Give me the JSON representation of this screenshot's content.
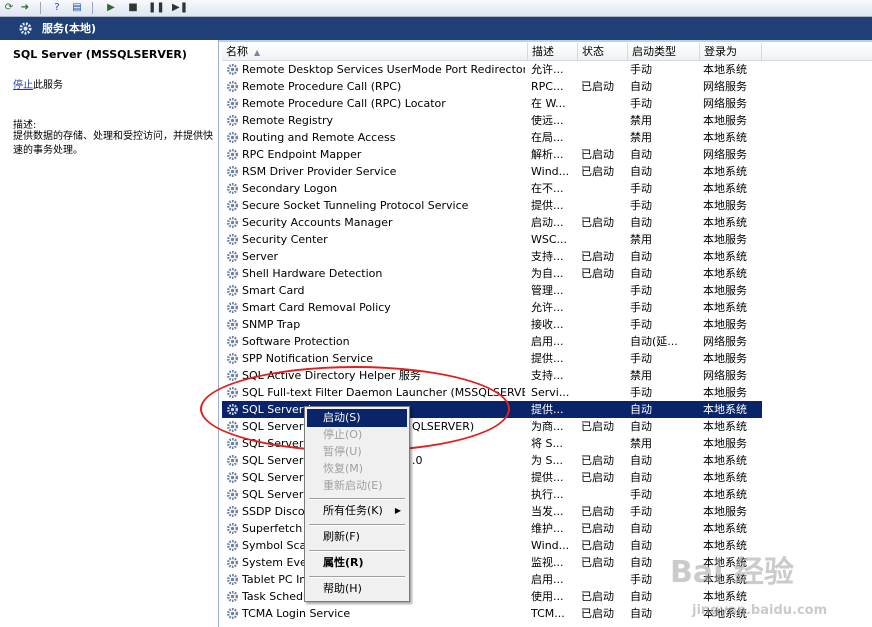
{
  "header": {
    "title": "服务(本地)"
  },
  "left_pane": {
    "service_title": "SQL Server (MSSQLSERVER)",
    "stop_link": "停止",
    "stop_suffix": "此服务",
    "desc_label": "描述:",
    "desc_text": "提供数据的存储、处理和受控访问，并提供快速的事务处理。"
  },
  "columns": [
    "名称",
    "描述",
    "状态",
    "启动类型",
    "登录为"
  ],
  "services": [
    {
      "name": "Remote Desktop Services UserMode Port Redirector",
      "desc": "允许...",
      "status": "",
      "startup": "手动",
      "logon": "本地系统"
    },
    {
      "name": "Remote Procedure Call (RPC)",
      "desc": "RPC...",
      "status": "已启动",
      "startup": "自动",
      "logon": "网络服务"
    },
    {
      "name": "Remote Procedure Call (RPC) Locator",
      "desc": "在 W...",
      "status": "",
      "startup": "手动",
      "logon": "网络服务"
    },
    {
      "name": "Remote Registry",
      "desc": "使远...",
      "status": "",
      "startup": "禁用",
      "logon": "本地服务"
    },
    {
      "name": "Routing and Remote Access",
      "desc": "在局...",
      "status": "",
      "startup": "禁用",
      "logon": "本地系统"
    },
    {
      "name": "RPC Endpoint Mapper",
      "desc": "解析...",
      "status": "已启动",
      "startup": "自动",
      "logon": "网络服务"
    },
    {
      "name": "RSM Driver Provider Service",
      "desc": "Wind...",
      "status": "已启动",
      "startup": "自动",
      "logon": "本地系统"
    },
    {
      "name": "Secondary Logon",
      "desc": "在不...",
      "status": "",
      "startup": "手动",
      "logon": "本地系统"
    },
    {
      "name": "Secure Socket Tunneling Protocol Service",
      "desc": "提供...",
      "status": "",
      "startup": "手动",
      "logon": "本地服务"
    },
    {
      "name": "Security Accounts Manager",
      "desc": "启动...",
      "status": "已启动",
      "startup": "自动",
      "logon": "本地系统"
    },
    {
      "name": "Security Center",
      "desc": "WSC...",
      "status": "",
      "startup": "禁用",
      "logon": "本地服务"
    },
    {
      "name": "Server",
      "desc": "支持...",
      "status": "已启动",
      "startup": "自动",
      "logon": "本地系统"
    },
    {
      "name": "Shell Hardware Detection",
      "desc": "为自...",
      "status": "已启动",
      "startup": "自动",
      "logon": "本地系统"
    },
    {
      "name": "Smart Card",
      "desc": "管理...",
      "status": "",
      "startup": "手动",
      "logon": "本地服务"
    },
    {
      "name": "Smart Card Removal Policy",
      "desc": "允许...",
      "status": "",
      "startup": "手动",
      "logon": "本地系统"
    },
    {
      "name": "SNMP Trap",
      "desc": "接收...",
      "status": "",
      "startup": "手动",
      "logon": "本地服务"
    },
    {
      "name": "Software Protection",
      "desc": "启用...",
      "status": "",
      "startup": "自动(延...",
      "logon": "网络服务"
    },
    {
      "name": "SPP Notification Service",
      "desc": "提供...",
      "status": "",
      "startup": "手动",
      "logon": "本地服务"
    },
    {
      "name": "SQL Active Directory Helper 服务",
      "desc": "支持...",
      "status": "",
      "startup": "禁用",
      "logon": "网络服务"
    },
    {
      "name": "SQL Full-text Filter Daemon Launcher (MSSQLSERVER)",
      "desc": "Servi...",
      "status": "",
      "startup": "手动",
      "logon": "本地服务"
    },
    {
      "name": "SQL Server (",
      "desc": "提供...",
      "status": "",
      "startup": "自动",
      "logon": "本地系统",
      "selected": true
    },
    {
      "name": "SQL Server A",
      "name_tail": "QLSERVER)",
      "desc": "为商...",
      "status": "已启动",
      "startup": "自动",
      "logon": "本地系统"
    },
    {
      "name": "SQL Server B",
      "desc": "将 S...",
      "status": "",
      "startup": "禁用",
      "logon": "本地服务"
    },
    {
      "name": "SQL Server I",
      "name_tail": ".0",
      "desc": "为 S...",
      "status": "已启动",
      "startup": "自动",
      "logon": "本地系统"
    },
    {
      "name": "SQL Server V",
      "desc": "提供...",
      "status": "已启动",
      "startup": "自动",
      "logon": "本地系统"
    },
    {
      "name": "SQL Server 代",
      "desc": "执行...",
      "status": "",
      "startup": "手动",
      "logon": "本地系统"
    },
    {
      "name": "SSDP Discove",
      "desc": "当发...",
      "status": "已启动",
      "startup": "手动",
      "logon": "本地服务"
    },
    {
      "name": "Superfetch",
      "desc": "维护...",
      "status": "已启动",
      "startup": "自动",
      "logon": "本地系统"
    },
    {
      "name": "Symbol Scan",
      "desc": "Wind...",
      "status": "已启动",
      "startup": "自动",
      "logon": "本地系统"
    },
    {
      "name": "System Even",
      "desc": "监视...",
      "status": "已启动",
      "startup": "自动",
      "logon": "本地系统"
    },
    {
      "name": "Tablet PC Inp",
      "desc": "启用...",
      "status": "",
      "startup": "手动",
      "logon": "本地系统"
    },
    {
      "name": "Task Schedu",
      "desc": "使用...",
      "status": "已启动",
      "startup": "自动",
      "logon": "本地系统"
    },
    {
      "name": "TCMA Login Service",
      "desc": "TCM...",
      "status": "已启动",
      "startup": "自动",
      "logon": "本地系统"
    }
  ],
  "context_menu": {
    "items": [
      {
        "label": "启动(S)",
        "state": "highlighted"
      },
      {
        "label": "停止(O)",
        "state": "disabled"
      },
      {
        "label": "暂停(U)",
        "state": "disabled"
      },
      {
        "label": "恢复(M)",
        "state": "disabled"
      },
      {
        "label": "重新启动(E)",
        "state": "disabled"
      },
      {
        "label": "所有任务(K)",
        "state": "normal",
        "submenu": true
      },
      {
        "label": "刷新(F)",
        "state": "normal"
      },
      {
        "label": "属性(R)",
        "state": "bold"
      },
      {
        "label": "帮助(H)",
        "state": "normal"
      }
    ]
  },
  "watermark": {
    "big": "Bai 经验",
    "small": "jingyan.baidu.com"
  },
  "colors": {
    "header_bg": "#1f3f76",
    "selection": "#0a246a",
    "annotation": "#e02020"
  },
  "icons": [
    "service-gear-icon",
    "back-icon",
    "forward-icon",
    "play-icon",
    "stop-icon",
    "pause-icon",
    "restart-icon",
    "help-icon"
  ]
}
